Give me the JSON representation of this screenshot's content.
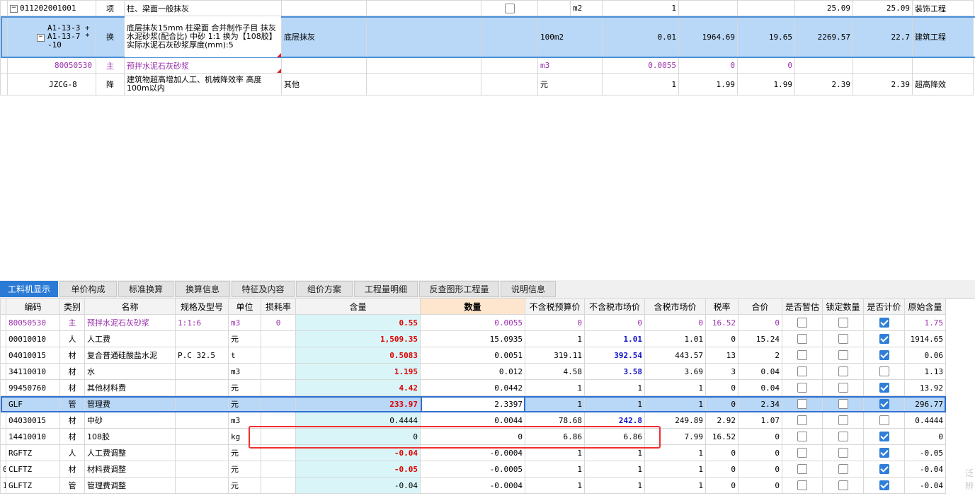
{
  "top_rows": [
    {
      "code": "011202001001",
      "type": "项",
      "name": "柱、梁面一般抹灰",
      "feature": "",
      "unit": "m2",
      "qty": "1",
      "price": "",
      "sum": "",
      "mprice": "25.09",
      "msum": "25.09",
      "prof": "装饰工程",
      "checkbox": true
    },
    {
      "code_line1": "A1-13-3 +",
      "code_line2": "A1-13-7 *",
      "code_line3": "-10",
      "type": "换",
      "name": "底层抹灰15mm 柱梁面 合并制作子目 抹灰水泥砂浆(配合比) 中砂 1:1 换为【108胶】 实际水泥石灰砂浆厚度(mm):5",
      "feature": "底层抹灰",
      "unit": "100m2",
      "qty": "0.01",
      "price": "1964.69",
      "sum": "19.65",
      "mprice": "2269.57",
      "msum": "22.7",
      "prof": "建筑工程"
    },
    {
      "code": "80050530",
      "type": "主",
      "name": "预拌水泥石灰砂浆",
      "feature": "",
      "unit": "m3",
      "qty": "0.0055",
      "price": "0",
      "sum": "0",
      "mprice": "",
      "msum": "",
      "prof": ""
    },
    {
      "code": "JZCG-8",
      "type": "降",
      "name": "建筑物超高增加人工、机械降效率 高度100m以内",
      "feature": "其他",
      "unit": "元",
      "qty": "1",
      "price": "1.99",
      "sum": "1.99",
      "mprice": "2.39",
      "msum": "2.39",
      "prof": "超高降效"
    }
  ],
  "tabs": [
    "工料机显示",
    "单价构成",
    "标准换算",
    "换算信息",
    "特征及内容",
    "组价方案",
    "工程量明细",
    "反查图形工程量",
    "说明信息"
  ],
  "columns": [
    "编码",
    "类别",
    "名称",
    "规格及型号",
    "单位",
    "损耗率",
    "含量",
    "数量",
    "不含税预算价",
    "不含税市场价",
    "含税市场价",
    "税率",
    "合价",
    "是否暂估",
    "锁定数量",
    "是否计价",
    "原始含量"
  ],
  "rows": [
    {
      "idx": "",
      "code": "80050530",
      "cat": "主",
      "name": "预拌水泥石灰砂浆",
      "spec": "1:1:6",
      "unit": "m3",
      "loss": "0",
      "content": "0.55",
      "qty": "0.0055",
      "budget": "0",
      "market": "0",
      "taxmarket": "0",
      "tax": "16.52",
      "total": "0",
      "est": false,
      "lock": false,
      "priced": true,
      "orig": "1.75"
    },
    {
      "idx": "",
      "code": "00010010",
      "cat": "人",
      "name": "人工费",
      "spec": "",
      "unit": "元",
      "loss": "",
      "content": "1,509.35",
      "qty": "15.0935",
      "budget": "1",
      "market": "1.01",
      "taxmarket": "1.01",
      "tax": "0",
      "total": "15.24",
      "est": false,
      "lock": false,
      "priced": true,
      "orig": "1914.65"
    },
    {
      "idx": "",
      "code": "04010015",
      "cat": "材",
      "name": "复合普通硅酸盐水泥",
      "spec": "P.C 32.5",
      "unit": "t",
      "loss": "",
      "content": "0.5083",
      "qty": "0.0051",
      "budget": "319.11",
      "market": "392.54",
      "taxmarket": "443.57",
      "tax": "13",
      "total": "2",
      "est": false,
      "lock": false,
      "priced": true,
      "orig": "0.06"
    },
    {
      "idx": "",
      "code": "34110010",
      "cat": "材",
      "name": "水",
      "spec": "",
      "unit": "m3",
      "loss": "",
      "content": "1.195",
      "qty": "0.012",
      "budget": "4.58",
      "market": "3.58",
      "taxmarket": "3.69",
      "tax": "3",
      "total": "0.04",
      "est": false,
      "lock": false,
      "priced": false,
      "orig": "1.13"
    },
    {
      "idx": "",
      "code": "99450760",
      "cat": "材",
      "name": "其他材料费",
      "spec": "",
      "unit": "元",
      "loss": "",
      "content": "4.42",
      "qty": "0.0442",
      "budget": "1",
      "market": "1",
      "taxmarket": "1",
      "tax": "0",
      "total": "0.04",
      "est": false,
      "lock": false,
      "priced": true,
      "orig": "13.92"
    },
    {
      "idx": "",
      "code": "GLF",
      "cat": "管",
      "name": "管理费",
      "spec": "",
      "unit": "元",
      "loss": "",
      "content": "233.97",
      "qty": "2.3397",
      "budget": "1",
      "market": "1",
      "taxmarket": "1",
      "tax": "0",
      "total": "2.34",
      "est": false,
      "lock": false,
      "priced": true,
      "orig": "296.77"
    },
    {
      "idx": "",
      "code": "04030015",
      "cat": "材",
      "name": "中砂",
      "spec": "",
      "unit": "m3",
      "loss": "",
      "content": "0.4444",
      "qty": "0.0044",
      "budget": "78.68",
      "market": "242.8",
      "taxmarket": "249.89",
      "tax": "2.92",
      "total": "1.07",
      "est": false,
      "lock": false,
      "priced": false,
      "orig": "0.4444"
    },
    {
      "idx": "",
      "code": "14410010",
      "cat": "材",
      "name": "108胶",
      "spec": "",
      "unit": "kg",
      "loss": "",
      "content": "0",
      "qty": "0",
      "budget": "6.86",
      "market": "6.86",
      "taxmarket": "7.99",
      "tax": "16.52",
      "total": "0",
      "est": false,
      "lock": false,
      "priced": true,
      "orig": "0"
    },
    {
      "idx": "",
      "code": "RGFTZ",
      "cat": "人",
      "name": "人工费调整",
      "spec": "",
      "unit": "元",
      "loss": "",
      "content": "-0.04",
      "qty": "-0.0004",
      "budget": "1",
      "market": "1",
      "taxmarket": "1",
      "tax": "0",
      "total": "0",
      "est": false,
      "lock": false,
      "priced": true,
      "orig": "-0.05"
    },
    {
      "idx": "0",
      "code": "CLFTZ",
      "cat": "材",
      "name": "材料费调整",
      "spec": "",
      "unit": "元",
      "loss": "",
      "content": "-0.05",
      "qty": "-0.0005",
      "budget": "1",
      "market": "1",
      "taxmarket": "1",
      "tax": "0",
      "total": "0",
      "est": false,
      "lock": false,
      "priced": true,
      "orig": "-0.04"
    },
    {
      "idx": "1",
      "code": "GLFTZ",
      "cat": "管",
      "name": "管理费调整",
      "spec": "",
      "unit": "元",
      "loss": "",
      "content": "-0.04",
      "qty": "-0.0004",
      "budget": "1",
      "market": "1",
      "taxmarket": "1",
      "tax": "0",
      "total": "0",
      "est": false,
      "lock": false,
      "priced": true,
      "orig": "-0.04"
    }
  ]
}
